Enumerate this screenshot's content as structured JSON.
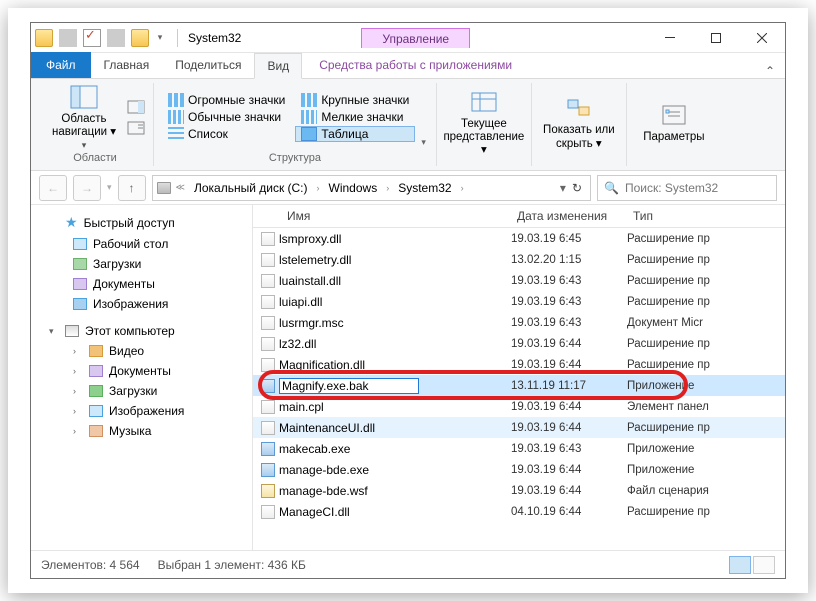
{
  "title": "System32",
  "manageTab": "Управление",
  "tabs": {
    "file": "Файл",
    "home": "Главная",
    "share": "Поделиться",
    "view": "Вид",
    "tools": "Средства работы с приложениями"
  },
  "ribbon": {
    "panes": {
      "label": "Области",
      "nav": "Область\nнавигации ▾"
    },
    "layout": {
      "label": "Структура",
      "huge": "Огромные значки",
      "large": "Крупные значки",
      "medium": "Обычные значки",
      "small": "Мелкие значки",
      "list": "Список",
      "table": "Таблица"
    },
    "view": {
      "label": "Текущее\nпредставление ▾"
    },
    "show": {
      "label": "Показать\nили скрыть ▾"
    },
    "opts": {
      "label": "Параметры"
    }
  },
  "breadcrumb": [
    "Локальный диск (C:)",
    "Windows",
    "System32"
  ],
  "search": {
    "placeholder": "Поиск: System32"
  },
  "tree": {
    "quick": "Быстрый доступ",
    "desktop": "Рабочий стол",
    "downloads": "Загрузки",
    "documents": "Документы",
    "pictures": "Изображения",
    "thispc": "Этот компьютер",
    "videos": "Видео",
    "documents2": "Документы",
    "downloads2": "Загрузки",
    "pictures2": "Изображения",
    "music": "Музыка"
  },
  "cols": {
    "name": "Имя",
    "date": "Дата изменения",
    "type": "Тип"
  },
  "files": [
    {
      "n": "lsmproxy.dll",
      "d": "19.03.19 6:45",
      "t": "Расширение пр",
      "i": "dll"
    },
    {
      "n": "lstelemetry.dll",
      "d": "13.02.20 1:15",
      "t": "Расширение пр",
      "i": "dll"
    },
    {
      "n": "luainstall.dll",
      "d": "19.03.19 6:43",
      "t": "Расширение пр",
      "i": "dll"
    },
    {
      "n": "luiapi.dll",
      "d": "19.03.19 6:43",
      "t": "Расширение пр",
      "i": "dll"
    },
    {
      "n": "lusrmgr.msc",
      "d": "19.03.19 6:43",
      "t": "Документ Micr",
      "i": "dll"
    },
    {
      "n": "lz32.dll",
      "d": "19.03.19 6:44",
      "t": "Расширение пр",
      "i": "dll"
    },
    {
      "n": "Magnification.dll",
      "d": "19.03.19 6:44",
      "t": "Расширение пр",
      "i": "dll"
    },
    {
      "n": "Magnify.exe.bak",
      "d": "13.11.19 11:17",
      "t": "Приложение",
      "i": "exe",
      "sel": true,
      "rename": true
    },
    {
      "n": "main.cpl",
      "d": "19.03.19 6:44",
      "t": "Элемент панел",
      "i": "dll"
    },
    {
      "n": "MaintenanceUI.dll",
      "d": "19.03.19 6:44",
      "t": "Расширение пр",
      "i": "dll",
      "sel2": true
    },
    {
      "n": "makecab.exe",
      "d": "19.03.19 6:43",
      "t": "Приложение",
      "i": "exe"
    },
    {
      "n": "manage-bde.exe",
      "d": "19.03.19 6:44",
      "t": "Приложение",
      "i": "exe"
    },
    {
      "n": "manage-bde.wsf",
      "d": "19.03.19 6:44",
      "t": "Файл сценария",
      "i": "wsf"
    },
    {
      "n": "ManageCI.dll",
      "d": "04.10.19 6:44",
      "t": "Расширение пр",
      "i": "dll"
    }
  ],
  "status": {
    "items": "Элементов: 4 564",
    "sel": "Выбран 1 элемент: 436 КБ"
  }
}
